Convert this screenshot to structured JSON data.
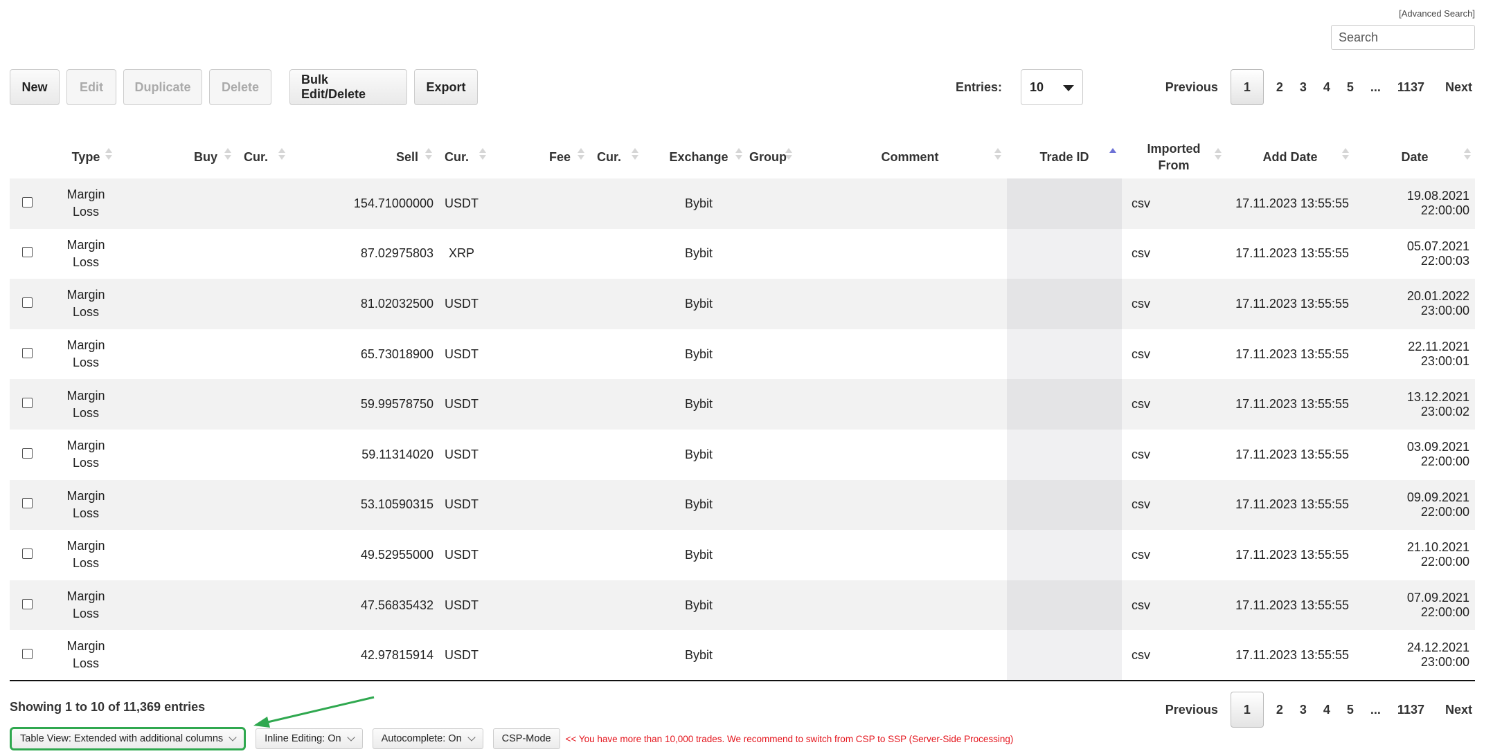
{
  "advanced_search": "[Advanced Search]",
  "search": {
    "placeholder": "Search"
  },
  "toolbar": {
    "new": "New",
    "edit": "Edit",
    "duplicate": "Duplicate",
    "delete": "Delete",
    "bulk": "Bulk Edit/Delete",
    "export": "Export"
  },
  "entries": {
    "label": "Entries:",
    "value": "10"
  },
  "pagination": {
    "previous": "Previous",
    "pages": [
      "1",
      "2",
      "3",
      "4",
      "5"
    ],
    "ellipsis": "...",
    "last": "1137",
    "next": "Next",
    "active": "1"
  },
  "columns": {
    "type": "Type",
    "buy": "Buy",
    "buy_cur": "Cur.",
    "sell": "Sell",
    "sell_cur": "Cur.",
    "fee": "Fee",
    "fee_cur": "Cur.",
    "exchange": "Exchange",
    "group": "Group",
    "comment": "Comment",
    "trade_id": "Trade ID",
    "imported_from_1": "Imported",
    "imported_from_2": "From",
    "add_date": "Add Date",
    "date": "Date"
  },
  "rows": [
    {
      "type1": "Margin",
      "type2": "Loss",
      "sell": "154.71000000",
      "sell_cur": "USDT",
      "exchange": "Bybit",
      "imported": "csv",
      "add_date": "17.11.2023 13:55:55",
      "date": "19.08.2021 22:00:00"
    },
    {
      "type1": "Margin",
      "type2": "Loss",
      "sell": "87.02975803",
      "sell_cur": "XRP",
      "exchange": "Bybit",
      "imported": "csv",
      "add_date": "17.11.2023 13:55:55",
      "date": "05.07.2021 22:00:03"
    },
    {
      "type1": "Margin",
      "type2": "Loss",
      "sell": "81.02032500",
      "sell_cur": "USDT",
      "exchange": "Bybit",
      "imported": "csv",
      "add_date": "17.11.2023 13:55:55",
      "date": "20.01.2022 23:00:00"
    },
    {
      "type1": "Margin",
      "type2": "Loss",
      "sell": "65.73018900",
      "sell_cur": "USDT",
      "exchange": "Bybit",
      "imported": "csv",
      "add_date": "17.11.2023 13:55:55",
      "date": "22.11.2021 23:00:01"
    },
    {
      "type1": "Margin",
      "type2": "Loss",
      "sell": "59.99578750",
      "sell_cur": "USDT",
      "exchange": "Bybit",
      "imported": "csv",
      "add_date": "17.11.2023 13:55:55",
      "date": "13.12.2021 23:00:02"
    },
    {
      "type1": "Margin",
      "type2": "Loss",
      "sell": "59.11314020",
      "sell_cur": "USDT",
      "exchange": "Bybit",
      "imported": "csv",
      "add_date": "17.11.2023 13:55:55",
      "date": "03.09.2021 22:00:00"
    },
    {
      "type1": "Margin",
      "type2": "Loss",
      "sell": "53.10590315",
      "sell_cur": "USDT",
      "exchange": "Bybit",
      "imported": "csv",
      "add_date": "17.11.2023 13:55:55",
      "date": "09.09.2021 22:00:00"
    },
    {
      "type1": "Margin",
      "type2": "Loss",
      "sell": "49.52955000",
      "sell_cur": "USDT",
      "exchange": "Bybit",
      "imported": "csv",
      "add_date": "17.11.2023 13:55:55",
      "date": "21.10.2021 22:00:00"
    },
    {
      "type1": "Margin",
      "type2": "Loss",
      "sell": "47.56835432",
      "sell_cur": "USDT",
      "exchange": "Bybit",
      "imported": "csv",
      "add_date": "17.11.2023 13:55:55",
      "date": "07.09.2021 22:00:00"
    },
    {
      "type1": "Margin",
      "type2": "Loss",
      "sell": "42.97815914",
      "sell_cur": "USDT",
      "exchange": "Bybit",
      "imported": "csv",
      "add_date": "17.11.2023 13:55:55",
      "date": "24.12.2021 23:00:00"
    }
  ],
  "footer": {
    "showing": "Showing 1 to 10 of 11,369 entries",
    "table_view": "Table View: Extended with additional columns",
    "inline_editing": "Inline Editing: On",
    "autocomplete": "Autocomplete: On",
    "csp_mode": "CSP-Mode",
    "warning": "<< You have more than 10,000 trades. We recommend to switch from CSP to SSP (Server-Side Processing)"
  },
  "colors": {
    "loss_red": "#e4141c",
    "highlight_green": "#2fa84f",
    "sort_active": "#6d72d6"
  }
}
